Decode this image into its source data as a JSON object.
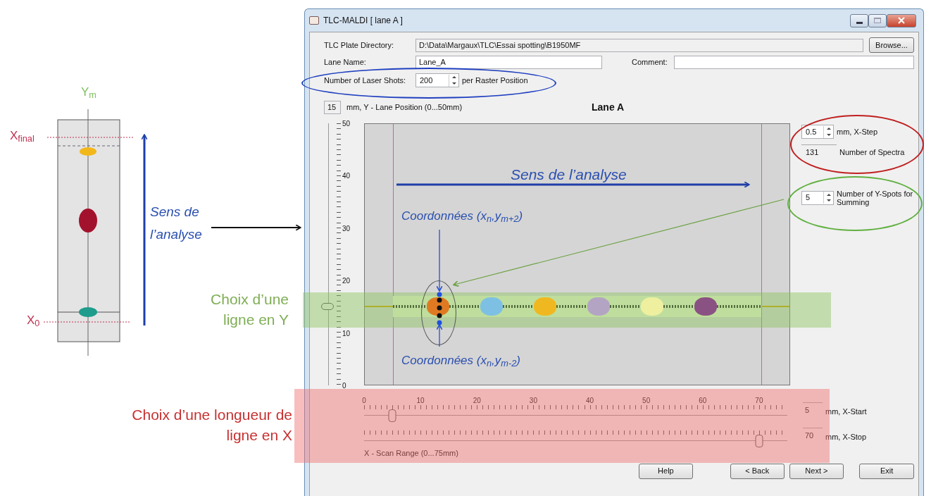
{
  "figure": {
    "lane_axis_label": "Y$_{m}$",
    "top_marker": "X$_{final}$",
    "bottom_marker": "X$_{0}$",
    "direction_label": "Sens de l’analyse",
    "spots": [
      {
        "color": "#f2b71a"
      },
      {
        "color": "#a3122c"
      },
      {
        "color": "#1f9c8c"
      }
    ]
  },
  "annotations": {
    "y_line_label": "Choix d’une ligne en Y",
    "x_length_label": "Choix d’une longueur de ligne en X",
    "plot_direction_label": "Sens de l’analyse",
    "upper_coordinates": "Coordonnées (x$_{n}$,y$_{m+2}$)",
    "lower_coordinates": "Coordonnées (x$_{n}$,y$_{m-2}$)"
  },
  "window": {
    "title": "TLC-MALDI  [ lane A ]",
    "plate_directory": {
      "label": "TLC Plate Directory:",
      "value": "D:\\Data\\Margaux\\TLC\\Essai spotting\\B1950MF"
    },
    "browse_button": "Browse...",
    "lane_name": {
      "label": "Lane Name:",
      "value": "Lane_A"
    },
    "comment": {
      "label": "Comment:"
    },
    "laser_shots": {
      "label": "Number of Laser Shots:",
      "value": "200",
      "unit": "per Raster Position"
    },
    "lane_position": {
      "value": "15",
      "label": "mm, Y - Lane Position (0...50mm)",
      "level": 0.3
    },
    "plot_title": "Lane A",
    "y_scale": [
      "50",
      "40",
      "30",
      "20",
      "10",
      "0"
    ],
    "x_step": {
      "value": "0.5",
      "label": "mm, X-Step"
    },
    "spectra": {
      "value": "131",
      "label": "Number of Spectra"
    },
    "y_spots": {
      "value": "5",
      "label": "Number of Y-Spots for Summing"
    },
    "lane_spots": [
      {
        "color": "#e07a22"
      },
      {
        "color": "#7ec0e4"
      },
      {
        "color": "#f0b820"
      },
      {
        "color": "#b4a4c4"
      },
      {
        "color": "#eef0a0"
      },
      {
        "color": "#8a5282"
      }
    ],
    "x_scale": [
      "0",
      "10",
      "20",
      "30",
      "40",
      "50",
      "60",
      "70"
    ],
    "x_start": {
      "value": "5",
      "label": "mm, X-Start",
      "level": 0.0667
    },
    "x_stop": {
      "value": "70",
      "label": "mm, X-Stop",
      "level": 0.9333
    },
    "scan_range_label": "X - Scan Range (0...75mm)",
    "buttons": [
      "Help",
      "< Back",
      "Next >",
      "Exit"
    ]
  }
}
